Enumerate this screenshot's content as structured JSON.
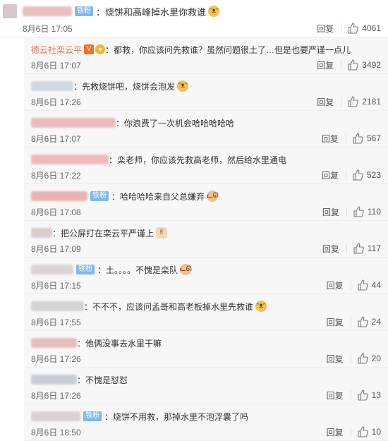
{
  "top_comment": {
    "badge": "铁粉",
    "text": "：烧饼和高峰掉水里你救谁",
    "time": "8月6日 17:05",
    "reply_label": "回复",
    "likes": "4061"
  },
  "replies": [
    {
      "name": "德云社栾云平",
      "badge": "",
      "text": "：都救，你应该问先救谁？虽然问题很土了…但是也要严谨一点儿",
      "time": "8月6日 17:07",
      "reply_label": "回复",
      "likes": "3492",
      "show_name": true
    },
    {
      "name": "",
      "badge": "",
      "text": "：先救烧饼吧，烧饼会泡发",
      "time": "8月6日 17:26",
      "reply_label": "回复",
      "likes": "2181",
      "show_name": false
    },
    {
      "name": "",
      "badge": "",
      "text": "：你浪费了一次机会哈哈哈哈哈",
      "time": "8月6日 17:07",
      "reply_label": "回复",
      "likes": "567",
      "show_name": false
    },
    {
      "name": "",
      "badge": "",
      "text": "：栾老师，你应该先救高老师，然后给水里通电",
      "time": "8月6日 17:22",
      "reply_label": "回复",
      "likes": "523",
      "show_name": false
    },
    {
      "name": "",
      "badge": "铁粉",
      "text": "：哈哈哈哈来自父总嫌弃",
      "time": "8月6日 17:08",
      "reply_label": "回复",
      "likes": "110",
      "show_name": false
    },
    {
      "name": "",
      "badge": "",
      "text": "：把公屏打在栾云平严谨上",
      "time": "8月6日 17:09",
      "reply_label": "回复",
      "likes": "117",
      "show_name": false
    },
    {
      "name": "",
      "badge": "铁粉",
      "text": "：土。。。。不愧是栾队",
      "time": "8月6日 17:15",
      "reply_label": "回复",
      "likes": "44",
      "show_name": false
    },
    {
      "name": "",
      "badge": "",
      "text": "：不不不，应该问孟哥和高老板掉水里先救谁",
      "time": "8月6日 17:55",
      "reply_label": "回复",
      "likes": "24",
      "show_name": false
    },
    {
      "name": "",
      "badge": "",
      "text": "：他俩没事去水里干嘛",
      "time": "8月6日 17:26",
      "reply_label": "回复",
      "likes": "20",
      "show_name": false
    },
    {
      "name": "",
      "badge": "",
      "text": "：不愧是怼怼",
      "time": "8月6日 17:26",
      "reply_label": "回复",
      "likes": "13",
      "show_name": false
    },
    {
      "name": "",
      "badge": "铁粉",
      "text": "：烧饼不用救，那掉水里不泡浮囊了吗",
      "time": "8月6日 18:50",
      "reply_label": "回复",
      "likes": "10",
      "show_name": false
    }
  ],
  "icons": {
    "like": "thumbs-up-icon",
    "emoji": "laughing-emoji-icon"
  }
}
